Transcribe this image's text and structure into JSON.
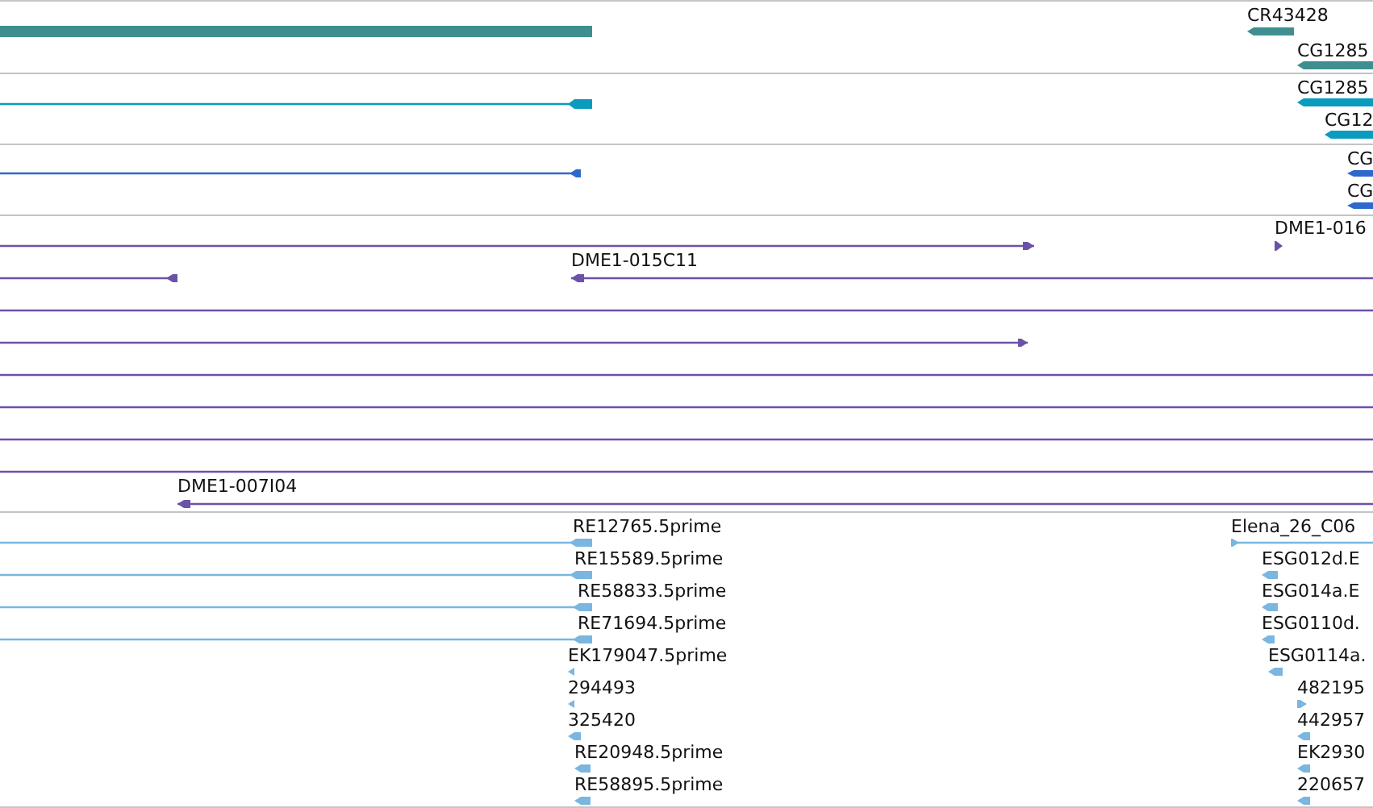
{
  "tracks": [
    {
      "color": "#3f8f90",
      "features": [
        {
          "kind": "plain"
        },
        {
          "label": "CR43428",
          "kind": "reverse"
        },
        {
          "label": "CG1285",
          "kind": "reverse"
        }
      ]
    },
    {
      "color": "#0a9bbd",
      "features": [
        {
          "kind": "reverse"
        },
        {
          "label": "CG1285",
          "kind": "reverse"
        },
        {
          "label": "CG12",
          "kind": "reverse"
        }
      ]
    },
    {
      "color": "#2f68cc",
      "features": [
        {
          "kind": "reverse"
        },
        {
          "label": "CG",
          "kind": "reverse"
        },
        {
          "label": "CG",
          "kind": "reverse"
        }
      ]
    },
    {
      "color": "#6b52a9",
      "features": [
        {
          "kind": "forward"
        },
        {
          "label": "DME1-016",
          "kind": "forward"
        },
        {
          "kind": "reverse"
        },
        {
          "label": "DME1-015C11",
          "kind": "reverse"
        },
        {
          "kind": "plain"
        },
        {
          "kind": "forward"
        },
        {
          "kind": "plain"
        },
        {
          "kind": "plain"
        },
        {
          "kind": "plain"
        },
        {
          "kind": "plain"
        },
        {
          "label": "DME1-007I04",
          "kind": "reverse"
        }
      ]
    },
    {
      "color": "#7ab6df",
      "features": [
        {
          "label": "RE12765.5prime",
          "kind": "reverse"
        },
        {
          "label": "Elena_26_C06",
          "kind": "forward"
        },
        {
          "label": "RE15589.5prime",
          "kind": "reverse"
        },
        {
          "label": "ESG012d.E",
          "kind": "reverse"
        },
        {
          "label": "RE58833.5prime",
          "kind": "reverse"
        },
        {
          "label": "ESG014a.E",
          "kind": "reverse"
        },
        {
          "label": "RE71694.5prime",
          "kind": "reverse"
        },
        {
          "label": "ESG0110d.",
          "kind": "reverse"
        },
        {
          "label": "EK179047.5prime",
          "kind": "reverse"
        },
        {
          "label": "ESG0114a.",
          "kind": "reverse"
        },
        {
          "label": "294493",
          "kind": "reverse"
        },
        {
          "label": "482195",
          "kind": "forward"
        },
        {
          "label": "325420",
          "kind": "reverse"
        },
        {
          "label": "442957",
          "kind": "reverse"
        },
        {
          "label": "RE20948.5prime",
          "kind": "reverse"
        },
        {
          "label": "EK2930",
          "kind": "reverse"
        },
        {
          "label": "RE58895.5prime",
          "kind": "reverse"
        },
        {
          "label": "220657",
          "kind": "reverse"
        }
      ]
    }
  ]
}
